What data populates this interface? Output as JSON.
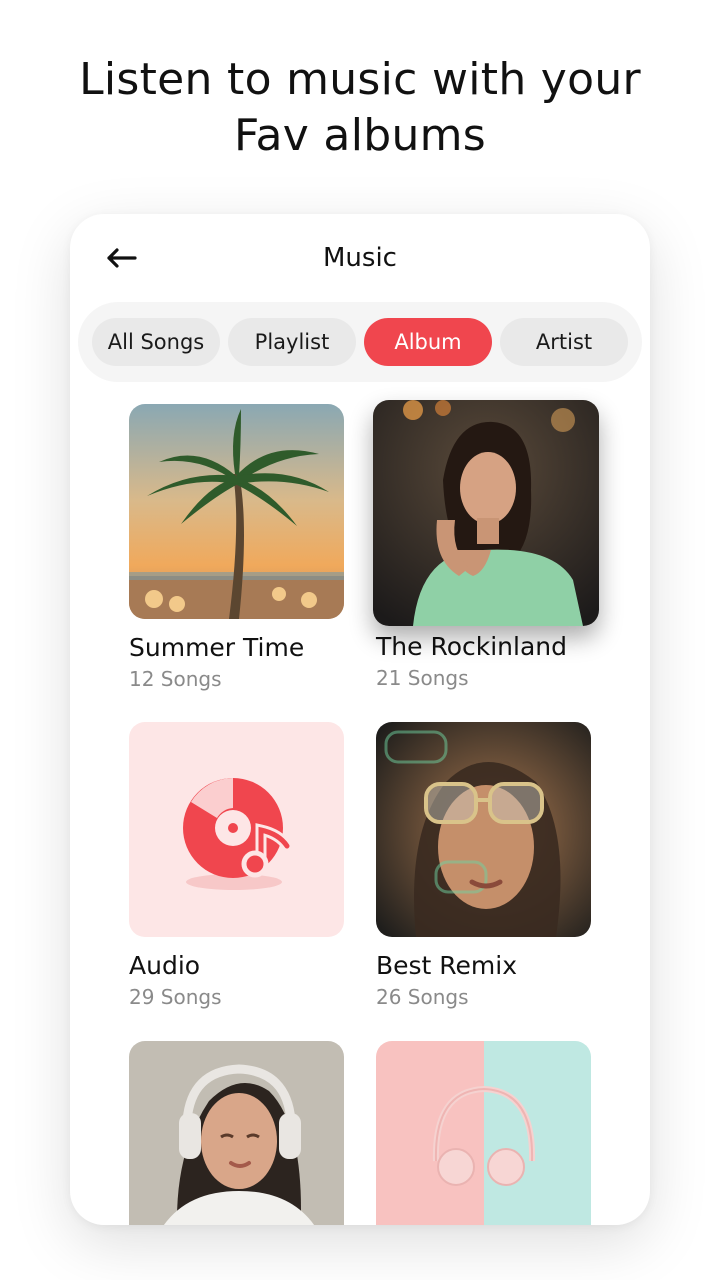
{
  "headline": {
    "line1": "Listen to music with your",
    "line2": "Fav albums"
  },
  "screen": {
    "title": "Music",
    "back_icon": "arrow-left-icon"
  },
  "tabs": [
    {
      "label": "All Songs",
      "active": false
    },
    {
      "label": "Playlist",
      "active": false
    },
    {
      "label": "Album",
      "active": true
    },
    {
      "label": "Artist",
      "active": false
    }
  ],
  "albums": [
    {
      "title": "Summer Time",
      "count": "12 Songs",
      "art": "palm-beach-photo"
    },
    {
      "title": "The Rockinland",
      "count": "21 Songs",
      "art": "woman-portrait-photo"
    },
    {
      "title": "Audio",
      "count": "29 Songs",
      "art": "vinyl-music-note-icon"
    },
    {
      "title": "Best Remix",
      "count": "26 Songs",
      "art": "woman-sunglasses-photo"
    },
    {
      "title": "",
      "count": "",
      "art": "woman-headphones-photo"
    },
    {
      "title": "",
      "count": "",
      "art": "pink-headphones-photo"
    }
  ],
  "colors": {
    "accent": "#f0464e",
    "tab_inactive": "#e9e9e9",
    "tab_track": "#f5f5f5",
    "audio_tile_bg": "#fde6e6"
  }
}
